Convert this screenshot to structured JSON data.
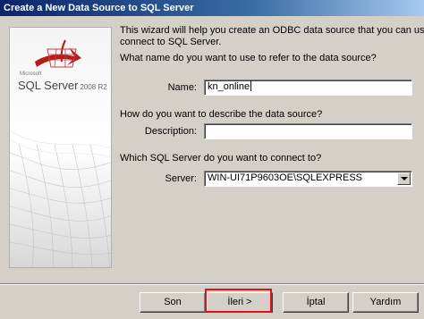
{
  "window": {
    "title": "Create a New Data Source to SQL Server"
  },
  "banner": {
    "brand_small": "Microsoft",
    "product_name": "SQL Server",
    "product_version": "2008 R2"
  },
  "intro": {
    "line1": "This wizard will help you create an ODBC data source that you can use to",
    "line2": "connect to SQL Server."
  },
  "name_section": {
    "question": "What name do you want to use to refer to the data source?",
    "label": "Name:",
    "value": "kn_online"
  },
  "description_section": {
    "question": "How do you want to describe the data source?",
    "label": "Description:",
    "value": ""
  },
  "server_section": {
    "question": "Which SQL Server do you want to connect to?",
    "label": "Server:",
    "value": "WIN-UI71P9603OE\\SQLEXPRESS"
  },
  "buttons": {
    "finish": "Son",
    "next": "İleri >",
    "cancel": "İptal",
    "help": "Yardım"
  },
  "colors": {
    "highlight": "#e0101a",
    "title_bar": "#0a246a",
    "face": "#d4d0c8"
  }
}
